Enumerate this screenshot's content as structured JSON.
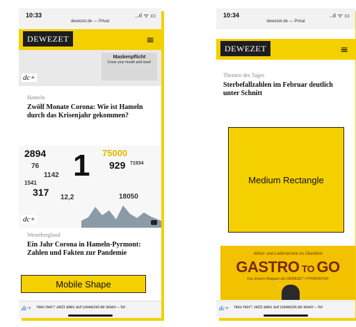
{
  "left": {
    "status": {
      "time": "10:33",
      "url": "dewezet.de — Privat",
      "signal": "..ıl ᯤ ▭"
    },
    "logo": "DEWEZET",
    "menu_icon": "≡",
    "img_top": {
      "badge": "dc+",
      "sign_title": "Maskenpflicht",
      "sign_sub": "Cover your mouth and nose!"
    },
    "article1": {
      "kicker": "Hameln",
      "headline": "Zwölf Monate Corona: Wie ist Hameln durch das Krisenjahr gekommen?"
    },
    "infographic": {
      "numbers": [
        "2894",
        "75000",
        "76",
        "929",
        "71934",
        "1142",
        "1541",
        "317",
        "12,2",
        "18050",
        "1"
      ],
      "badge": "dc+"
    },
    "article2": {
      "kicker": "Weserbergland",
      "headline": "Ein Jahr Corona in Hameln-Pyrmont: Zahlen und Fakten zur Pandemie"
    },
    "ad_label": "Mobile Shape",
    "bottom": {
      "badge": "dc+",
      "text": "Neu hier? Jetzt alles auf Dewezet.de lesen – für"
    }
  },
  "right": {
    "status": {
      "time": "10:34",
      "url": "dewezet.de — Privat",
      "signal": "..ıl ᯤ ▭"
    },
    "logo": "DEWEZET",
    "menu_icon": "≡",
    "article1": {
      "kicker": "Themen des Tages",
      "headline": "Sterbefallzahlen im Februar deutlich unter Schnitt"
    },
    "ad_label": "Medium Rectangle",
    "gastro": {
      "line1": "Abhol- und Lieferservice im Überblick",
      "title_a": "GASTRO",
      "title_b": " TO ",
      "title_c": "GO",
      "line2": "Das leckere Magazin der DEWEZET / PYRMONTER"
    },
    "bottom": {
      "badge": "dc+",
      "text": "Neu hier? Jetzt alles auf Dewezet.de lesen – für"
    }
  },
  "colors": {
    "brand_yellow": "#f4d000",
    "logo_black": "#1d1d1d"
  }
}
